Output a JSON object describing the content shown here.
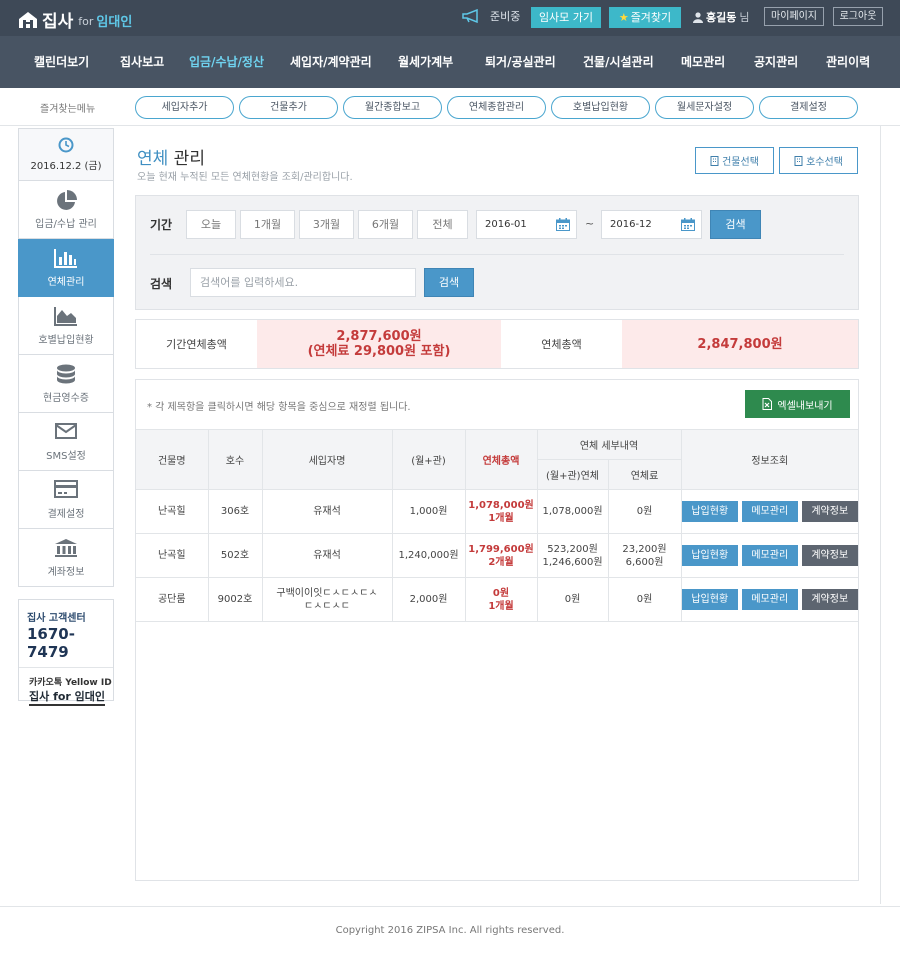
{
  "header": {
    "logo_main": "집사",
    "logo_for": "for",
    "logo_tag": "임대인",
    "prep_label": "준비중",
    "imsamo_button": "임사모 가기",
    "favorites_button": "즐겨찾기",
    "user_name": "홍길동",
    "user_suffix": "님",
    "mypage_button": "마이페이지",
    "logout_button": "로그아웃"
  },
  "nav": {
    "items": [
      {
        "label": "캘린더보기"
      },
      {
        "label": "집사보고"
      },
      {
        "label": "입금/수납/정산"
      },
      {
        "label": "세입자/계약관리"
      },
      {
        "label": "월세가계부"
      },
      {
        "label": "퇴거/공실관리"
      },
      {
        "label": "건물/시설관리"
      },
      {
        "label": "메모관리"
      },
      {
        "label": "공지관리"
      },
      {
        "label": "관리이력"
      }
    ],
    "active_index": 2
  },
  "favbar": {
    "label": "즐겨찾는메뉴",
    "items": [
      {
        "label": "세입자추가"
      },
      {
        "label": "건물추가"
      },
      {
        "label": "월간종합보고"
      },
      {
        "label": "연체종합관리"
      },
      {
        "label": "호별납입현황"
      },
      {
        "label": "월세문자설정"
      },
      {
        "label": "결제설정"
      }
    ]
  },
  "sidebar": {
    "date": "2016.12.2 (금)",
    "items": [
      {
        "label": "입금/수납 관리",
        "icon": "pie-chart-icon"
      },
      {
        "label": "연체관리",
        "icon": "bar-chart-icon",
        "active": true
      },
      {
        "label": "호별납입현황",
        "icon": "area-chart-icon"
      },
      {
        "label": "현금영수증",
        "icon": "database-icon"
      },
      {
        "label": "SMS설정",
        "icon": "envelope-icon"
      },
      {
        "label": "결제설정",
        "icon": "credit-card-icon"
      },
      {
        "label": "계좌정보",
        "icon": "bank-icon"
      }
    ],
    "cs_brand": "집사",
    "cs_title": "고객센터",
    "cs_phone": "1670-7479",
    "kakao_label": "카카오톡 Yellow ID",
    "kakao_name": "집사 for 임대인"
  },
  "main": {
    "title_highlight": "연체",
    "title_rest": " 관리",
    "subtitle": "오늘 현재 누적된 모든 연체현황을 조회/관리합니다.",
    "building_select": "건물선택",
    "unit_select": "호수선택"
  },
  "filter": {
    "period_label": "기간",
    "period_buttons": [
      "오늘",
      "1개월",
      "3개월",
      "6개월",
      "전체"
    ],
    "date_from": "2016-01",
    "date_to": "2016-12",
    "tilde": "~",
    "period_search": "검색",
    "search_label": "검색",
    "search_placeholder": "검색어를 입력하세요.",
    "search_button": "검색"
  },
  "summary": {
    "period_total_label": "기간연체총액",
    "period_total_value": "2,877,600원",
    "period_total_fee": "(연체료 29,800원 포함)",
    "total_label": "연체총액",
    "total_value": "2,847,800원"
  },
  "table": {
    "note": "* 각 제목항을 클릭하시면 해당 항목을 중심으로 재정렬 됩니다.",
    "excel_button": "엑셀내보내기",
    "headers": {
      "building": "건물명",
      "unit": "호수",
      "tenant": "세입자명",
      "rent": "(월+관)",
      "overdue_total": "연체총액",
      "detail_group": "연체 세부내역",
      "detail_rent": "(월+관)연체",
      "detail_fee": "연체료",
      "info": "정보조회"
    },
    "action_labels": {
      "payment": "납입현황",
      "memo": "메모관리",
      "contract": "계약정보"
    },
    "rows": [
      {
        "building": "난곡힐",
        "unit": "306호",
        "tenant": "유재석",
        "rent": "1,000원",
        "overdue_amount": "1,078,000원",
        "overdue_months": "1개월",
        "detail_rent_1": "1,078,000원",
        "detail_rent_2": "",
        "detail_fee_1": "0원",
        "detail_fee_2": ""
      },
      {
        "building": "난곡힐",
        "unit": "502호",
        "tenant": "유재석",
        "rent": "1,240,000원",
        "overdue_amount": "1,799,600원",
        "overdue_months": "2개월",
        "detail_rent_1": "523,200원",
        "detail_rent_2": "1,246,600원",
        "detail_fee_1": "23,200원",
        "detail_fee_2": "6,600원"
      },
      {
        "building": "공단룸",
        "unit": "9002호",
        "tenant": "구백이이잇ㄷㅅㄷㅅㄷㅅ",
        "tenant_2": "ㄷㅅㄷㅅㄷ",
        "rent": "2,000원",
        "overdue_amount": "0원",
        "overdue_months": "1개월",
        "detail_rent_1": "0원",
        "detail_rent_2": "",
        "detail_fee_1": "0원",
        "detail_fee_2": ""
      }
    ]
  },
  "footer": {
    "copyright": "Copyright 2016 ZIPSA Inc. All rights reserved."
  },
  "colors": {
    "topbar": "#3e4957",
    "nav": "#485463",
    "accent": "#4a97c9",
    "active_nav": "#6fd3f0",
    "overdue_red": "#c43b3b",
    "excel_green": "#2e8a4e"
  }
}
